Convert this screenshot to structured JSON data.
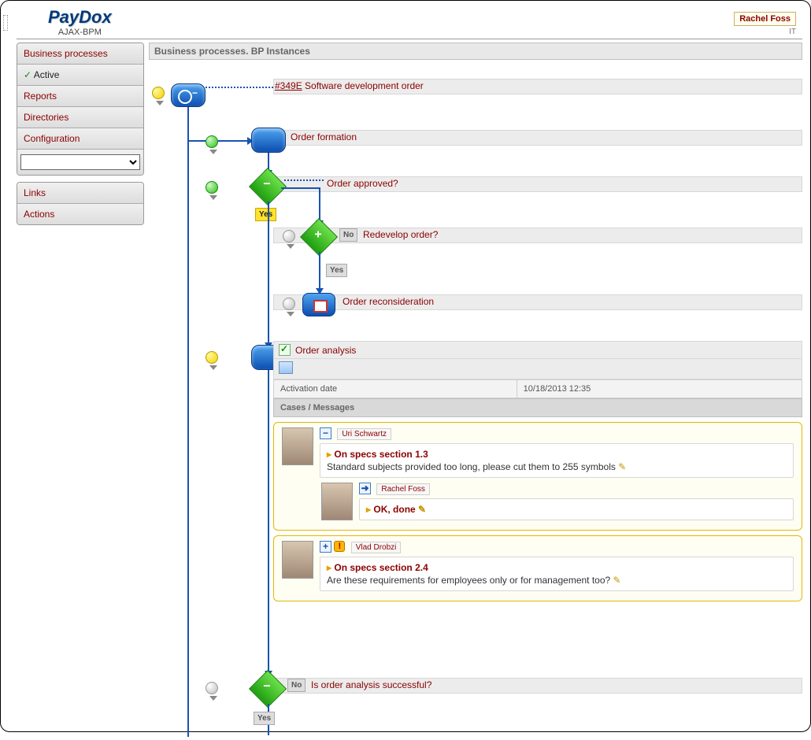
{
  "logo": {
    "title": "PayDox",
    "subtitle": "AJAX-BPM"
  },
  "user": {
    "name": "Rachel Foss",
    "dept": "IT"
  },
  "sidebar": {
    "items": [
      "Business processes",
      "Active",
      "Reports",
      "Directories",
      "Configuration"
    ],
    "items2": [
      "Links",
      "Actions"
    ]
  },
  "main_heading": "Business processes. BP Instances",
  "process": {
    "id_link": "#349E",
    "id_text": "Software development order",
    "steps": {
      "formation": "Order formation",
      "approved_q": "Order approved?",
      "redevelop_q": "Redevelop order?",
      "reconsider": "Order reconsideration",
      "analysis": "Order analysis",
      "analysis_q": "Is order analysis successful?"
    },
    "badges": {
      "yes": "Yes",
      "no": "No",
      "yes2": "Yes",
      "no2": "No",
      "yes3": "Yes"
    }
  },
  "detail": {
    "activation_label": "Activation date",
    "activation_value": "10/18/2013 12:35",
    "cases_label": "Cases / Messages",
    "threads": [
      {
        "author": "Uri Schwartz",
        "toggle": "−",
        "subj": "On specs section 1.3",
        "body": "Standard subjects provided too long, please cut them to 255 symbols",
        "reply": {
          "author": "Rachel Foss",
          "text": "OK, done"
        }
      },
      {
        "author": "Vlad Drobzi",
        "toggle": "+",
        "alert": true,
        "subj": "On specs section 2.4",
        "body": "Are these requirements for employees only or for management too?"
      }
    ]
  }
}
